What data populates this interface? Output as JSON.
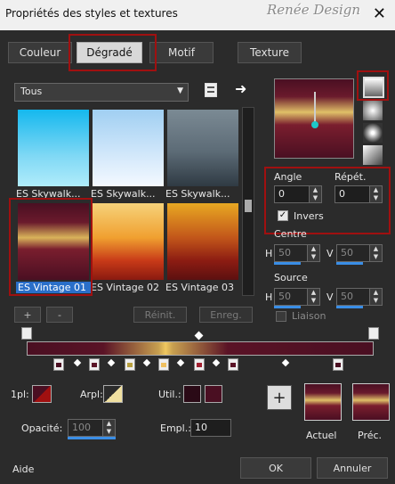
{
  "window": {
    "title": "Propriétés des styles et textures",
    "watermark": "Renée Design"
  },
  "tabs": [
    {
      "label": "Couleur"
    },
    {
      "label": "Dégradé"
    },
    {
      "label": "Motif"
    },
    {
      "label": "Texture"
    }
  ],
  "category": {
    "value": "Tous"
  },
  "gradients": [
    {
      "label": "ES Skywalk..."
    },
    {
      "label": "ES Skywalk..."
    },
    {
      "label": "ES Skywalk..."
    },
    {
      "label": "ES Vintage 01"
    },
    {
      "label": "ES Vintage 02"
    },
    {
      "label": "ES Vintage 03"
    }
  ],
  "buttons": {
    "add": "+",
    "remove": "-",
    "reset": "Réinit.",
    "save": "Enreg."
  },
  "angle": {
    "label": "Angle",
    "value": "0"
  },
  "repeat": {
    "label": "Répét.",
    "value": "0"
  },
  "invert": {
    "label": "Invers",
    "checked": true
  },
  "centre": {
    "label": "Centre",
    "h_label": "H",
    "h": "50",
    "v_label": "V",
    "v": "50"
  },
  "source": {
    "label": "Source",
    "h_label": "H",
    "h": "50",
    "v_label": "V",
    "v": "50"
  },
  "link": {
    "label": "Liaison"
  },
  "bottom": {
    "pl_label": "1pl:",
    "arpl_label": "Arpl:",
    "util_label": "Util.:",
    "opacity_label": "Opacité:",
    "opacity": "100",
    "empl_label": "Empl.:",
    "empl": "10",
    "current_label": "Actuel",
    "previous_label": "Préc.",
    "add": "+"
  },
  "footer": {
    "help": "Aide",
    "ok": "OK",
    "cancel": "Annuler"
  },
  "colors": {
    "dark": "#4a0f22",
    "maroon": "#5a1326",
    "gold": "#e8c060",
    "accent": "#3a8ee6",
    "highlight": "#a01010"
  }
}
